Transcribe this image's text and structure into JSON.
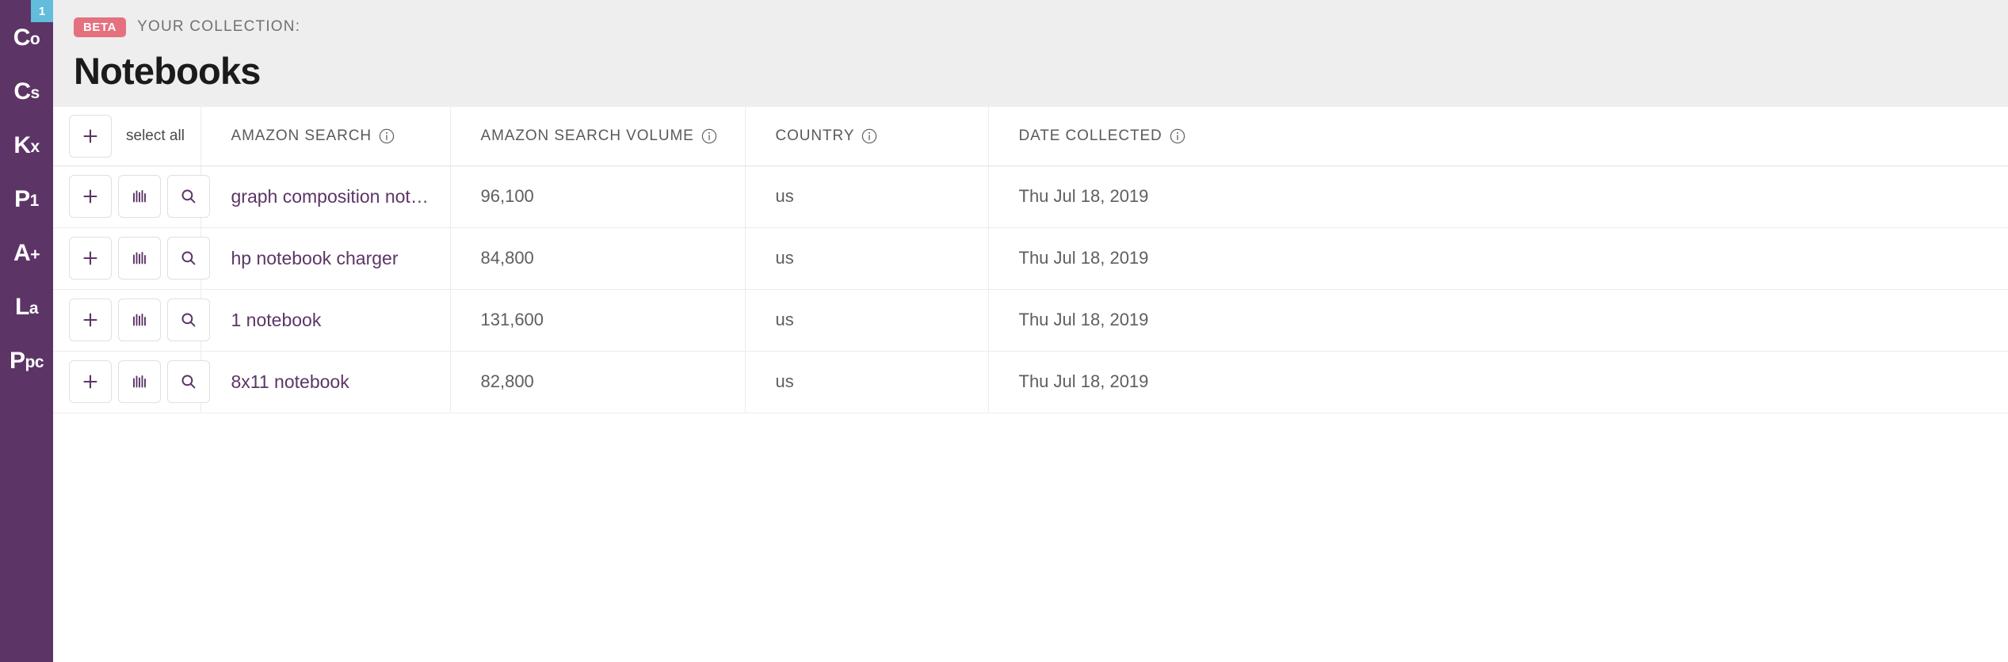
{
  "sidebar": {
    "badge_count": "1",
    "brand_color": "#5c3566",
    "badge_color": "#62bcdb",
    "items": [
      {
        "label_main": "C",
        "label_rest": "o",
        "name": "sidebar-item-co"
      },
      {
        "label_main": "C",
        "label_rest": "s",
        "name": "sidebar-item-cs"
      },
      {
        "label_main": "K",
        "label_rest": "x",
        "name": "sidebar-item-kx"
      },
      {
        "label_main": "P",
        "label_rest": "1",
        "name": "sidebar-item-p1"
      },
      {
        "label_main": "A",
        "label_rest": "+",
        "name": "sidebar-item-a-plus"
      },
      {
        "label_main": "L",
        "label_rest": "a",
        "name": "sidebar-item-la"
      },
      {
        "label_main": "P",
        "label_rest": "pc",
        "name": "sidebar-item-ppc"
      }
    ]
  },
  "header": {
    "beta_label": "BETA",
    "collection_label": "YOUR COLLECTION:",
    "title": "Notebooks",
    "beta_color": "#e5717f",
    "background": "#eeeeee"
  },
  "table": {
    "select_all_label": "select all",
    "columns": [
      {
        "key": "actions",
        "label": ""
      },
      {
        "key": "search",
        "label": "AMAZON SEARCH",
        "info": true
      },
      {
        "key": "volume",
        "label": "AMAZON SEARCH VOLUME",
        "info": true
      },
      {
        "key": "country",
        "label": "COUNTRY",
        "info": true
      },
      {
        "key": "date",
        "label": "DATE COLLECTED",
        "info": true
      }
    ],
    "row_actions": [
      {
        "icon": "plus-icon",
        "title": "add"
      },
      {
        "icon": "bar-chart-icon",
        "title": "trend"
      },
      {
        "icon": "search-icon",
        "title": "search"
      }
    ],
    "rows": [
      {
        "search": "graph composition notebo...",
        "volume": "96,100",
        "country": "us",
        "date": "Thu Jul 18, 2019"
      },
      {
        "search": "hp notebook charger",
        "volume": "84,800",
        "country": "us",
        "date": "Thu Jul 18, 2019"
      },
      {
        "search": "1 notebook",
        "volume": "131,600",
        "country": "us",
        "date": "Thu Jul 18, 2019"
      },
      {
        "search": "8x11 notebook",
        "volume": "82,800",
        "country": "us",
        "date": "Thu Jul 18, 2019"
      }
    ]
  }
}
